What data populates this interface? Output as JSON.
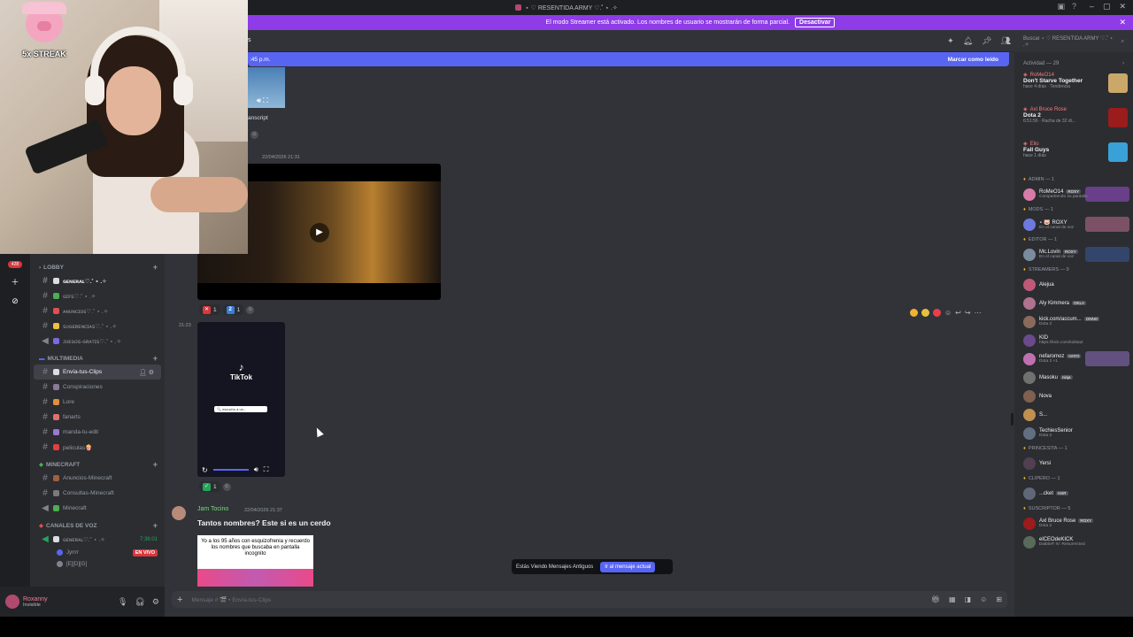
{
  "titlebar": {
    "title": "⋆ ♡ RESENTIDA ARMY ♡.˚ ⋆ .✧"
  },
  "streamer_banner": {
    "text": "El modo Streamer está activado. Los nombres de usuario se mostrarán de forma parcial.",
    "button": "Desactivar"
  },
  "webcam": {
    "streak": "5x STREAK"
  },
  "sidebar": {
    "categories": [
      {
        "name": "LOBBY",
        "channels": [
          {
            "label": "ɢᴇɴᴇʀᴀʟ♡.˚ ⋆ .✧",
            "bold": true
          },
          {
            "label": "ɢɪꜰꜱ♡.˚ ⋆ .✧"
          },
          {
            "label": "ᴀɴᴜɴᴄɪᴏꜱ♡.˚ ⋆ .✧"
          },
          {
            "label": "ꜱᴜɢᴇʀᴇɴᴄɪᴀꜱ♡.˚ ⋆ .✧"
          },
          {
            "label": "ᴊᴜᴇɢᴏꜱ-ɢʀᴀᴛɪꜱ♡.˚ ⋆ .✧"
          }
        ]
      },
      {
        "name": "MULTIMEDIA",
        "channels": [
          {
            "label": "Envía-tus-Clips",
            "active": true
          },
          {
            "label": "Conspiraciones"
          },
          {
            "label": "Lore"
          },
          {
            "label": "fanarts"
          },
          {
            "label": "manda-tu-edit"
          },
          {
            "label": "peliculas🍿"
          }
        ]
      },
      {
        "name": "MINECRAFT",
        "channels": [
          {
            "label": "Anuncios-Minecraft"
          },
          {
            "label": "Consultas-Minecraft"
          },
          {
            "label": "Minecraft"
          }
        ]
      },
      {
        "name": "CANALES DE VOZ",
        "channels": [
          {
            "label": "ɢᴇɴᴇʀᴀʟ♡.˚ ⋆ .✧",
            "time": "7:36:01"
          }
        ]
      }
    ],
    "voice_users": [
      {
        "name": "Jyrrrr",
        "live": "EN VIVO"
      },
      {
        "name": "[E][D][G]"
      }
    ]
  },
  "user_panel": {
    "name": "Roxanny",
    "status": "Invisible"
  },
  "chat": {
    "new_bar": {
      "time": ":45 p.m.",
      "mark_read": "Marcar como leído"
    },
    "transcript": "anscript",
    "ts1": "22/04/2026 21:31",
    "ts2": "21:23",
    "reactions1": [
      {
        "icon": "✕",
        "count": "1"
      },
      {
        "icon": "2",
        "count": "1"
      }
    ],
    "reactions2": [
      {
        "icon": "✓",
        "count": "1"
      }
    ],
    "tiktok": {
      "logo": "TikTok",
      "search": "🔍 escucho a un..."
    },
    "message": {
      "author": "Jam Tocino",
      "timestamp": "22/04/2026 21:37",
      "text": "Tantos nombres? Este si es un cerdo",
      "meme_caption": "Yo a los  95 años con esquizofrenia y recuerdo los nombres que buscaba en pantalla incognito"
    },
    "jump": {
      "text": "Estás Viendo Mensajes Antiguos",
      "button": "Ir al mensaje actual"
    },
    "composer_placeholder": "Mensaje # 🎬 • Envía-tus-Clips"
  },
  "search": {
    "placeholder": "Buscar ⋆ ♡ RESENTIDA ARMY ♡.˚ ⋆ .✧"
  },
  "right_panel": {
    "activity_header": "Actividad — 29",
    "activities": [
      {
        "who": "RoMeO14",
        "game": "Don't Starve Together",
        "meta": "hace 4 días  ·  Tendencia",
        "color": "#c9a86a"
      },
      {
        "who": "Axl Bruce Rose",
        "game": "Dota 2",
        "meta": "6:51:56  ·  Racha de 32 di...",
        "color": "#9b1c1c"
      },
      {
        "who": "Elio",
        "game": "Fall Guys",
        "meta": "hace 1 días",
        "color": "#3aa0d8"
      }
    ],
    "groups": [
      {
        "role": "ADMIN — 1",
        "members": [
          {
            "name": "RoMeO14",
            "sub": "Compartiendo su pantalla",
            "tag": "ROXY",
            "color": "#d97aa8",
            "banner": "#9a4fd0"
          }
        ]
      },
      {
        "role": "MODS — 1",
        "members": [
          {
            "name": "⋆ 🐷 ROXY",
            "sub": "En el canal de voz",
            "tag": "",
            "color": "#6e7ae0",
            "banner": "#c07090"
          }
        ]
      },
      {
        "role": "Editor — 1",
        "members": [
          {
            "name": "Mc.Lovin",
            "sub": "En el canal de voz",
            "tag": "ROXY",
            "color": "#7a8c9e",
            "banner": "#3a5a9a"
          }
        ]
      },
      {
        "role": "STREAMERS — 9",
        "members": [
          {
            "name": "Alejua",
            "sub": "",
            "tag": "",
            "color": "#c05878"
          },
          {
            "name": "Aly Kimmera",
            "sub": "",
            "tag": "OKLA",
            "color": "#b0728e"
          },
          {
            "name": "kick.com/accum...",
            "sub": "Dota 2",
            "tag": "ONNO",
            "color": "#8a6a5a"
          },
          {
            "name": "KID",
            "sub": "https://kick.com/kidsta2",
            "tag": "",
            "color": "#6a4a8a"
          },
          {
            "name": "nefaromoz",
            "sub": "Dota 2 +1",
            "tag": "HATO",
            "color": "#c070b0",
            "banner": "#9070c0"
          },
          {
            "name": "Masoku",
            "sub": "",
            "tag": "ninja",
            "color": "#707070"
          },
          {
            "name": "Nova",
            "sub": "",
            "tag": "",
            "color": "#806050"
          },
          {
            "name": "S...",
            "sub": "",
            "tag": "",
            "color": "#c09050"
          },
          {
            "name": "TechiesSenior",
            "sub": "Dota 2",
            "tag": "",
            "color": "#607080"
          }
        ]
      },
      {
        "role": "PRINCESITA — 1",
        "members": [
          {
            "name": "Yersi",
            "sub": "",
            "tag": "",
            "color": "#504050"
          }
        ]
      },
      {
        "role": "CLIPERO — 1",
        "members": [
          {
            "name": "...cket",
            "sub": "",
            "tag": "HSR",
            "color": "#606878"
          }
        ]
      },
      {
        "role": "SUSCRIPTOR — 5",
        "members": [
          {
            "name": "Axl Bruce Rose",
            "sub": "Dota 2",
            "tag": "ROXY",
            "color": "#9b1c1c"
          },
          {
            "name": "elCEOdeKICK",
            "sub": "Diablo® IV: Resurrected",
            "tag": "",
            "color": "#5a6a5a"
          }
        ]
      }
    ]
  }
}
